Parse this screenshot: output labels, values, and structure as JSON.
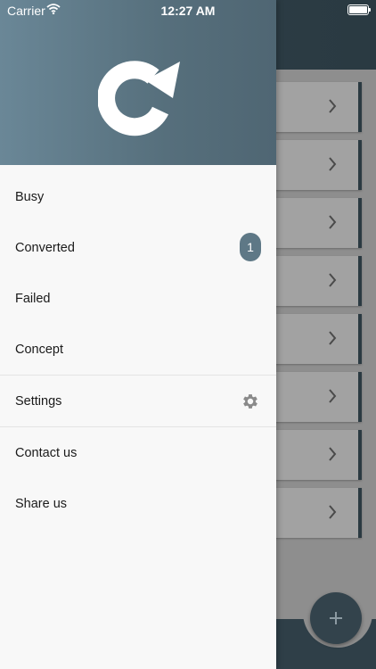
{
  "status_bar": {
    "carrier": "Carrier",
    "time": "12:27 AM"
  },
  "drawer": {
    "logo_icon": "refresh-arrow-icon",
    "items": [
      {
        "label": "Busy"
      },
      {
        "label": "Converted",
        "badge": "1"
      },
      {
        "label": "Failed"
      },
      {
        "label": "Concept"
      },
      {
        "label": "Settings",
        "icon": "gear-icon"
      },
      {
        "label": "Contact us"
      },
      {
        "label": "Share us"
      }
    ]
  },
  "background": {
    "fab_icon": "plus-icon",
    "card_icon": "chevron-right-icon"
  },
  "colors": {
    "header_accent": "#566f7c",
    "badge": "#5e7886",
    "app_bar": "#2f3f48"
  }
}
